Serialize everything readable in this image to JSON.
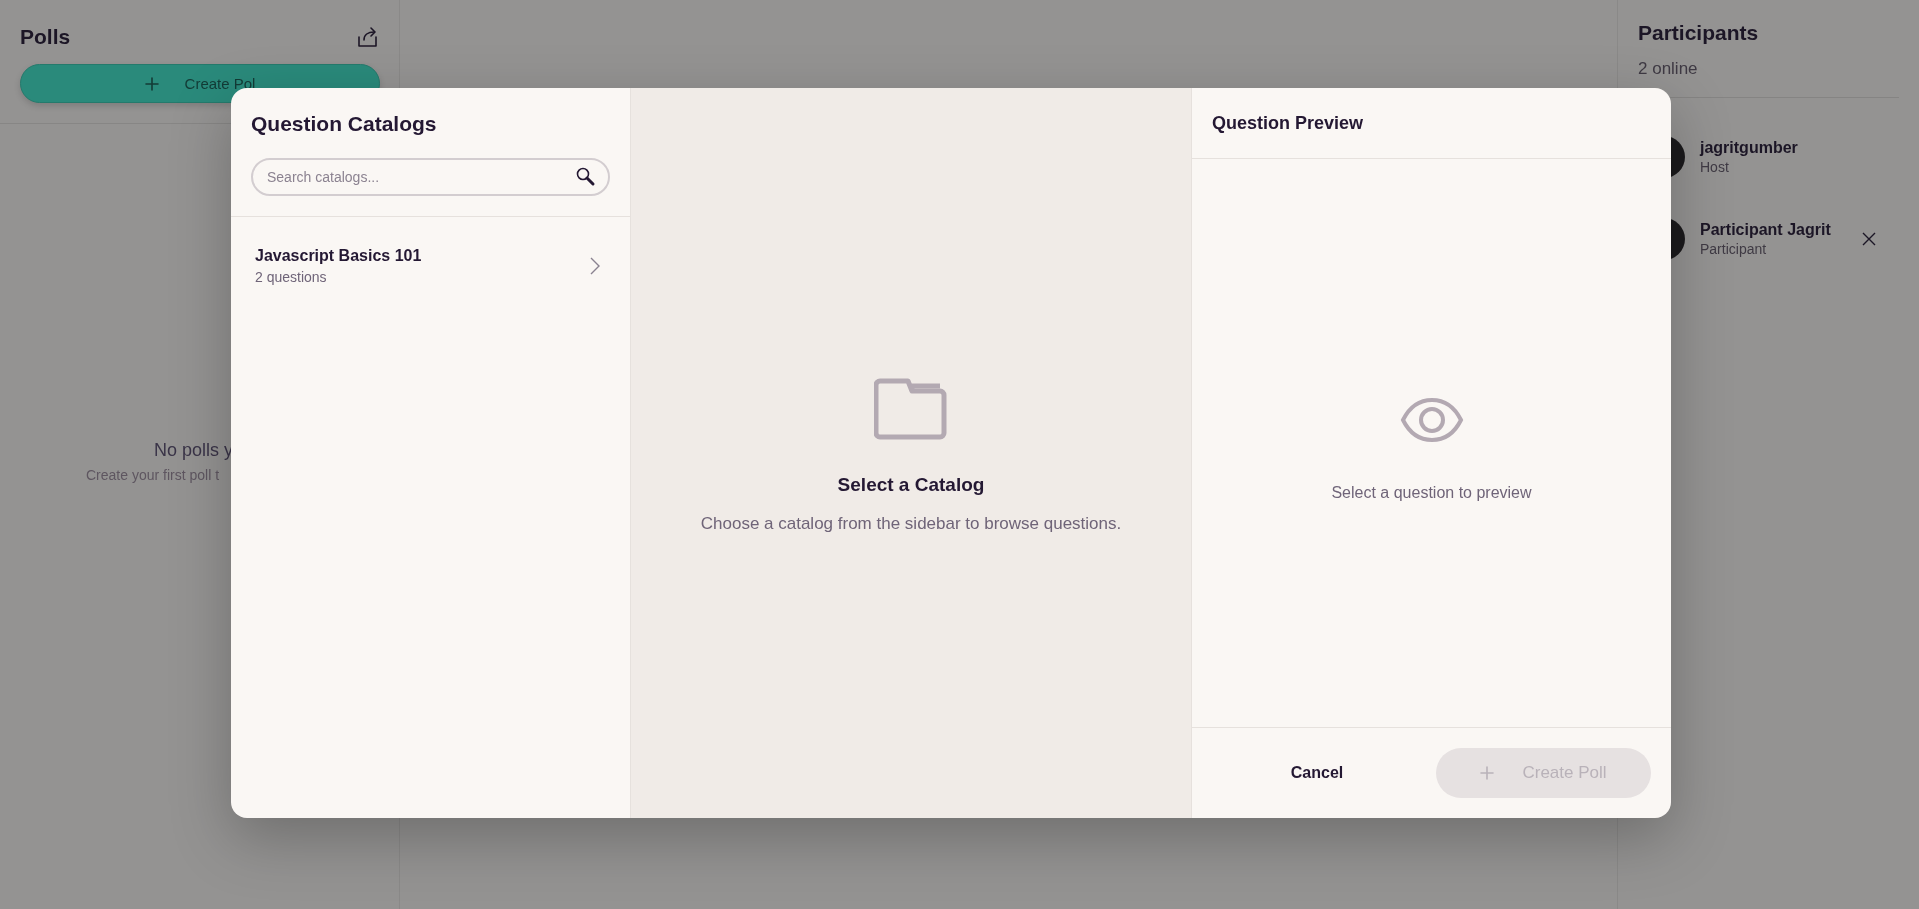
{
  "polls_panel": {
    "title": "Polls",
    "create_button": "Create Pol",
    "empty_title": "No polls y",
    "empty_subtitle": "Create your first poll t"
  },
  "participants": {
    "title": "Participants",
    "online": "2 online",
    "people": [
      {
        "name": "jagritgumber",
        "role": "Host",
        "removable": false
      },
      {
        "name": "Participant Jagrit",
        "role": "Participant",
        "removable": true
      }
    ]
  },
  "modal": {
    "catalogs": {
      "title": "Question Catalogs",
      "search": {
        "placeholder": "Search catalogs..."
      },
      "items": [
        {
          "name": "Javascript Basics 101",
          "count": "2 questions"
        }
      ]
    },
    "browser": {
      "title": "Select a Catalog",
      "message": "Choose a catalog from the sidebar to browse questions."
    },
    "preview": {
      "title": "Question Preview",
      "message": "Select a question to preview"
    },
    "buttons": [
      {
        "label": "Cancel",
        "kind": "text",
        "disabled": false
      },
      {
        "label": "Create Poll",
        "kind": "primary",
        "disabled": true
      }
    ]
  }
}
